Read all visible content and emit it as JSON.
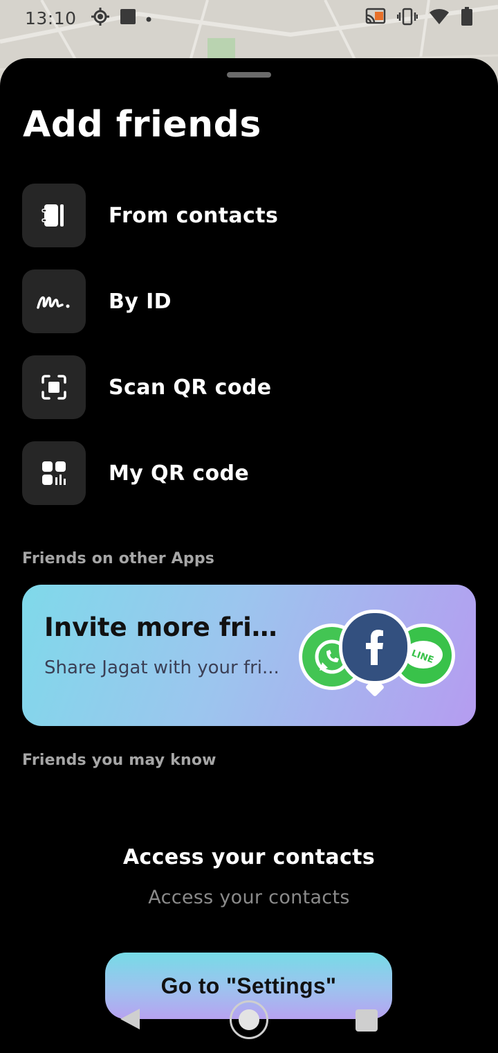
{
  "status_bar": {
    "time": "13:10"
  },
  "sheet": {
    "title": "Add friends"
  },
  "options": [
    {
      "label": "From contacts",
      "icon": "contacts-book-icon"
    },
    {
      "label": "By ID",
      "icon": "signature-icon"
    },
    {
      "label": "Scan QR code",
      "icon": "scan-frame-icon"
    },
    {
      "label": "My QR code",
      "icon": "qr-code-icon"
    }
  ],
  "sections": {
    "other_apps": "Friends on other Apps",
    "may_know": "Friends you may know"
  },
  "invite_banner": {
    "title": "Invite more frie...",
    "subtitle": "Share Jagat with your fri..."
  },
  "contacts_access": {
    "title": "Access your contacts",
    "subtitle": "Access your contacts",
    "button_label": "Go to \"Settings\""
  },
  "colors": {
    "background": "#000000",
    "tile": "#262626",
    "gradient_start": "#7fd9ea",
    "gradient_end": "#b59cf0",
    "section_label": "#a6a6a6"
  }
}
